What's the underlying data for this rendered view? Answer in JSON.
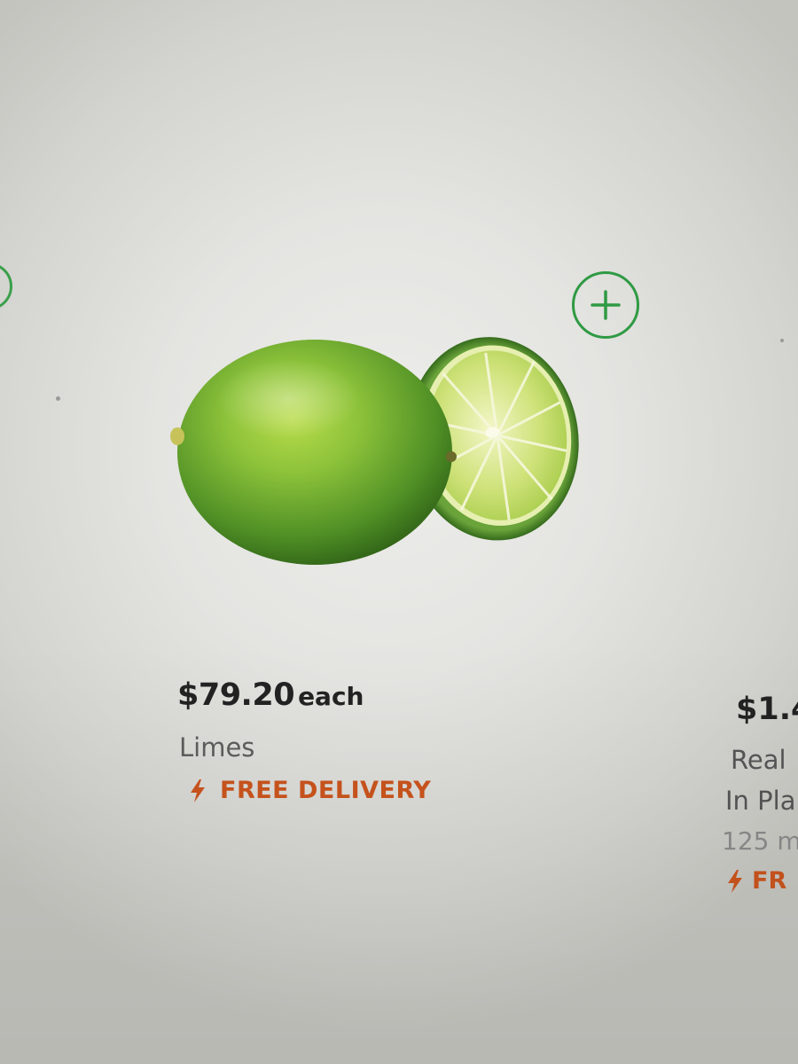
{
  "product": {
    "price": "$79.20",
    "unit": "each",
    "name": "Limes",
    "delivery_label": "FREE DELIVERY"
  },
  "next_product": {
    "price": "$1.4",
    "name_line1": "Real",
    "name_line2": "In Pla",
    "size": "125 m",
    "delivery_label": "FR"
  },
  "icons": {
    "add": "plus-circle-icon",
    "delivery": "lightning-bolt-icon"
  },
  "colors": {
    "add_button": "#2f9a43",
    "delivery": "#c9541d",
    "price": "#222222",
    "name": "#5d5d5d"
  }
}
